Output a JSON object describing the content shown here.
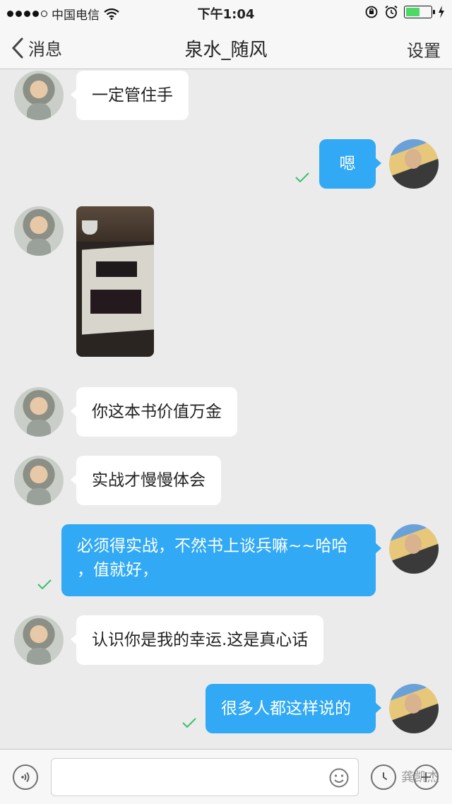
{
  "status_bar": {
    "carrier": "中国电信",
    "time": "下午1:04",
    "battery_level": 0.55
  },
  "nav": {
    "back_label": "消息",
    "title": "泉水_随风",
    "settings_label": "设置"
  },
  "messages": [
    {
      "from": "friend",
      "type": "text",
      "text": "一定管住手"
    },
    {
      "from": "me",
      "type": "text",
      "text": "嗯",
      "read": true
    },
    {
      "from": "friend",
      "type": "image",
      "icon": "photo-book-charts"
    },
    {
      "from": "friend",
      "type": "text",
      "text": "你这本书价值万金"
    },
    {
      "from": "friend",
      "type": "text",
      "text": "实战才慢慢体会"
    },
    {
      "from": "me",
      "type": "text",
      "text_line1": "必须得实战，不然书上谈兵嘛~~哈哈",
      "text_line2": "，值就好，",
      "read": true
    },
    {
      "from": "friend",
      "type": "text",
      "text": "认识你是我的幸运.这是真心话"
    },
    {
      "from": "me",
      "type": "text",
      "text": "很多人都这样说的",
      "read": true
    }
  ],
  "input_bar": {
    "voice_icon": "voice-icon",
    "emoji_icon": "emoji-icon",
    "clock_icon": "clock-icon",
    "add_icon": "plus-icon",
    "watermark": "龚凯杰"
  },
  "colors": {
    "outgoing_bubble": "#31a9f4",
    "incoming_bubble": "#ffffff",
    "background": "#ebebeb",
    "read_check": "#3cbf6a"
  }
}
